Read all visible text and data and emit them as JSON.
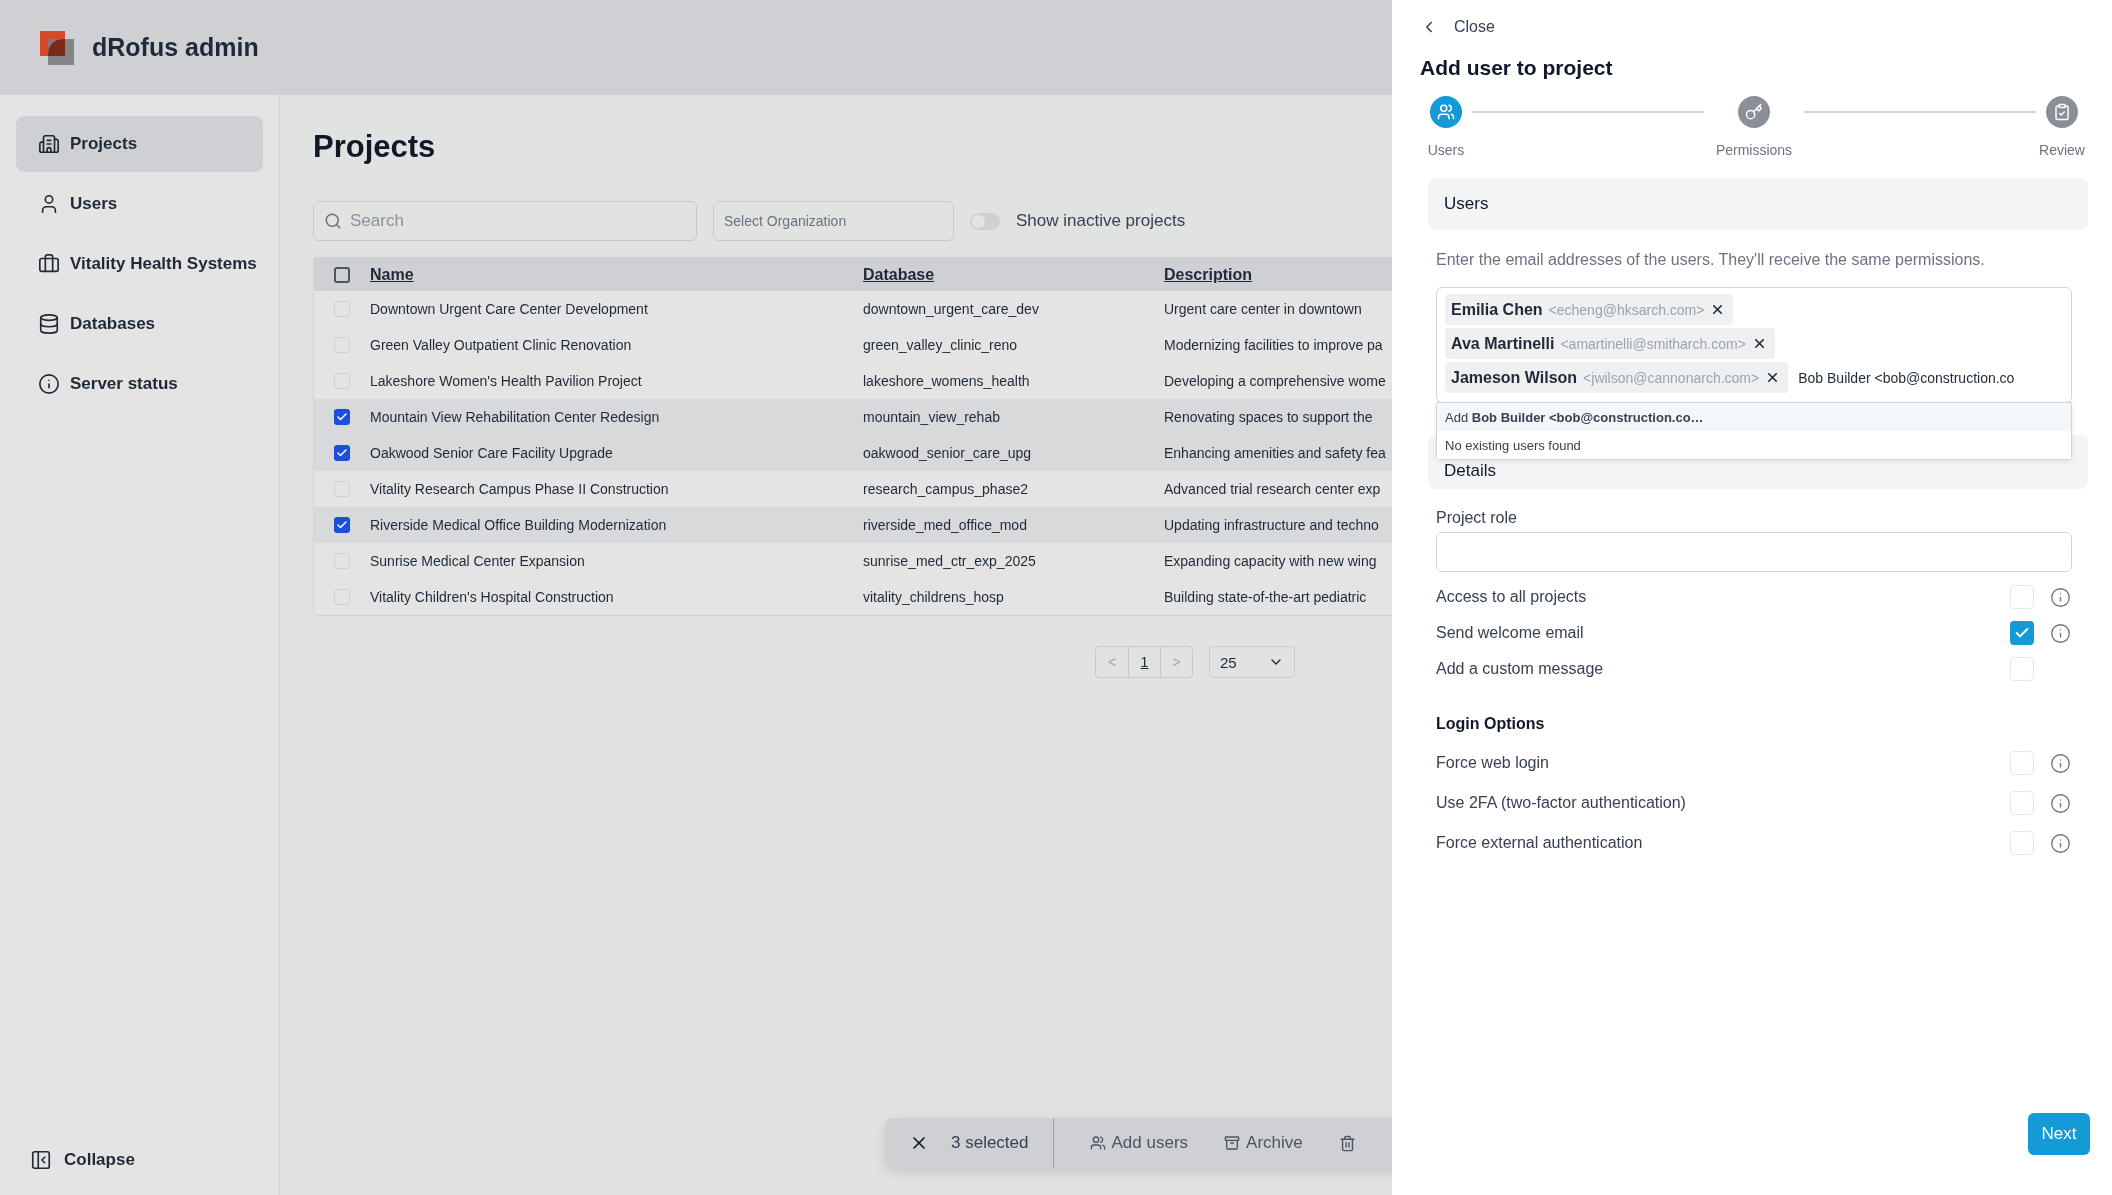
{
  "app": {
    "title": "dRofus admin"
  },
  "sidebar": {
    "items": [
      {
        "label": "Projects",
        "selected": true
      },
      {
        "label": "Users",
        "selected": false
      },
      {
        "label": "Vitality Health Systems",
        "selected": false
      },
      {
        "label": "Databases",
        "selected": false
      },
      {
        "label": "Server status",
        "selected": false
      }
    ],
    "collapse": "Collapse"
  },
  "page": {
    "title": "Projects",
    "search": {
      "placeholder": "Search"
    },
    "organization": {
      "placeholder": "Select Organization"
    },
    "inactive_toggle": {
      "label": "Show inactive projects",
      "on": false
    }
  },
  "table": {
    "select_all": {
      "checked": false
    },
    "columns": [
      "Name",
      "Database",
      "Description"
    ],
    "rows": [
      {
        "name": "Downtown Urgent Care Center Development",
        "database": "downtown_urgent_care_dev",
        "description": "Urgent care center in downtown",
        "selected": false
      },
      {
        "name": "Green Valley Outpatient Clinic Renovation",
        "database": "green_valley_clinic_reno",
        "description": "Modernizing facilities to improve pa",
        "selected": false
      },
      {
        "name": "Lakeshore Women's Health Pavilion Project",
        "database": "lakeshore_womens_health",
        "description": "Developing a comprehensive wome",
        "selected": false
      },
      {
        "name": "Mountain View Rehabilitation Center Redesign",
        "database": "mountain_view_rehab",
        "description": "Renovating spaces to support the",
        "selected": true
      },
      {
        "name": "Oakwood Senior Care Facility Upgrade",
        "database": "oakwood_senior_care_upg",
        "description": "Enhancing amenities and safety fea",
        "selected": true
      },
      {
        "name": "Vitality Research Campus Phase II Construction",
        "database": "research_campus_phase2",
        "description": "Advanced trial research center exp",
        "selected": false
      },
      {
        "name": "Riverside Medical Office Building Modernization",
        "database": "riverside_med_office_mod",
        "description": "Updating infrastructure and techno",
        "selected": true
      },
      {
        "name": "Sunrise Medical Center Expansion",
        "database": "sunrise_med_ctr_exp_2025",
        "description": "Expanding capacity with new wing",
        "selected": false
      },
      {
        "name": "Vitality Children's Hospital Construction",
        "database": "vitality_childrens_hosp",
        "description": "Building state-of-the-art pediatric",
        "selected": false
      }
    ]
  },
  "pagination": {
    "prev": "<",
    "page": "1",
    "next": ">",
    "page_size": "25"
  },
  "selection_bar": {
    "count": "3 selected",
    "actions": [
      "Add users",
      "Archive"
    ]
  },
  "drawer": {
    "close": "Close",
    "title": "Add user to project",
    "steps": [
      {
        "label": "Users",
        "selected": true
      },
      {
        "label": "Permissions",
        "selected": false
      },
      {
        "label": "Review",
        "selected": false
      }
    ],
    "users_section": {
      "title": "Users",
      "hint": "Enter the email addresses of the users. They'll receive the same permissions.",
      "chips": [
        {
          "name": "Emilia Chen",
          "email": "<echeng@hksarch.com>"
        },
        {
          "name": "Ava Martinelli",
          "email": "<amartinelli@smitharch.com>"
        },
        {
          "name": "Jameson Wilson",
          "email": "<jwilson@cannonarch.com>"
        }
      ],
      "input": "Bob Builder <bob@construction.co",
      "suggestions": [
        {
          "text": "Add **Bob Builder <bob@construction.co…**",
          "selected": true
        },
        {
          "text": "No existing users found",
          "selected": false
        }
      ]
    },
    "details_section": {
      "title": "Details",
      "role_label": "Project role"
    },
    "options": [
      {
        "label": "Access to all projects",
        "checked": false,
        "info": true
      },
      {
        "label": "Send welcome email",
        "checked": true,
        "info": true
      },
      {
        "label": "Add a custom message",
        "checked": false,
        "info": false
      }
    ],
    "login_title": "Login Options",
    "login_options": [
      {
        "label": "Force web login",
        "checked": false,
        "info": true
      },
      {
        "label": "Use 2FA (two-factor authentication)",
        "checked": false,
        "info": true
      },
      {
        "label": "Force external authentication",
        "checked": false,
        "info": true
      }
    ],
    "next": "Next"
  }
}
